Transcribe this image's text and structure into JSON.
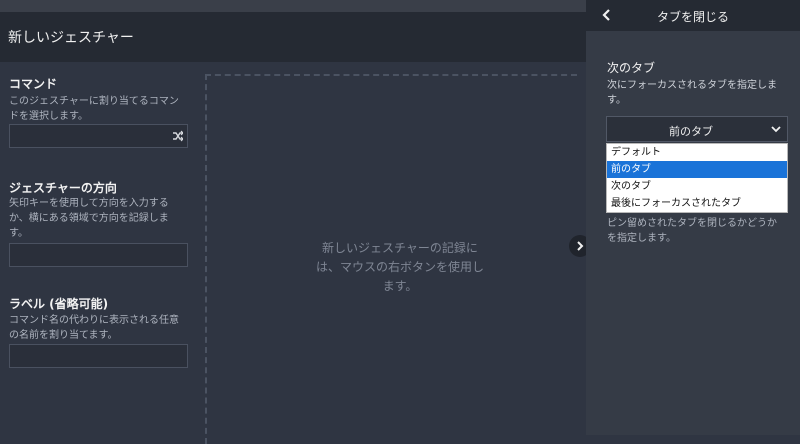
{
  "header": {
    "title": "新しいジェスチャー"
  },
  "command": {
    "title": "コマンド",
    "desc_lines": [
      "このジェスチャーに割り当てるコマン",
      "ドを選択します。"
    ],
    "icon": "shuffle-icon"
  },
  "direction": {
    "title": "ジェスチャーの方向",
    "desc_lines": [
      "矢印キーを使用して方向を入力する",
      "か、横にある領域で方向を記録しま",
      "す。"
    ]
  },
  "label": {
    "title": "ラベル (省略可能)",
    "desc_lines": [
      "コマンド名の代わりに表示される任意",
      "の名前を割り当てます。"
    ]
  },
  "drop_area": {
    "lines": [
      "新しいジェスチャーの記録に",
      "は、マウスの右ボタンを使用し",
      "ます。"
    ]
  },
  "panel": {
    "title": "タブを閉じる",
    "next_tab": {
      "label": "次のタブ",
      "desc_lines": [
        "次にフォーカスされるタブを指定しま",
        "す。"
      ],
      "selected": "前のタブ",
      "options": [
        "デフォルト",
        "前のタブ",
        "次のタブ",
        "最後にフォーカスされたタブ"
      ],
      "highlighted_index": 1
    },
    "pinned_desc_lines": [
      "ピン留めされたタブを閉じるかどうか",
      "を指定します。"
    ]
  },
  "colors": {
    "highlight": "#1a73d8",
    "background": "#2f3542",
    "header": "#252a33"
  }
}
